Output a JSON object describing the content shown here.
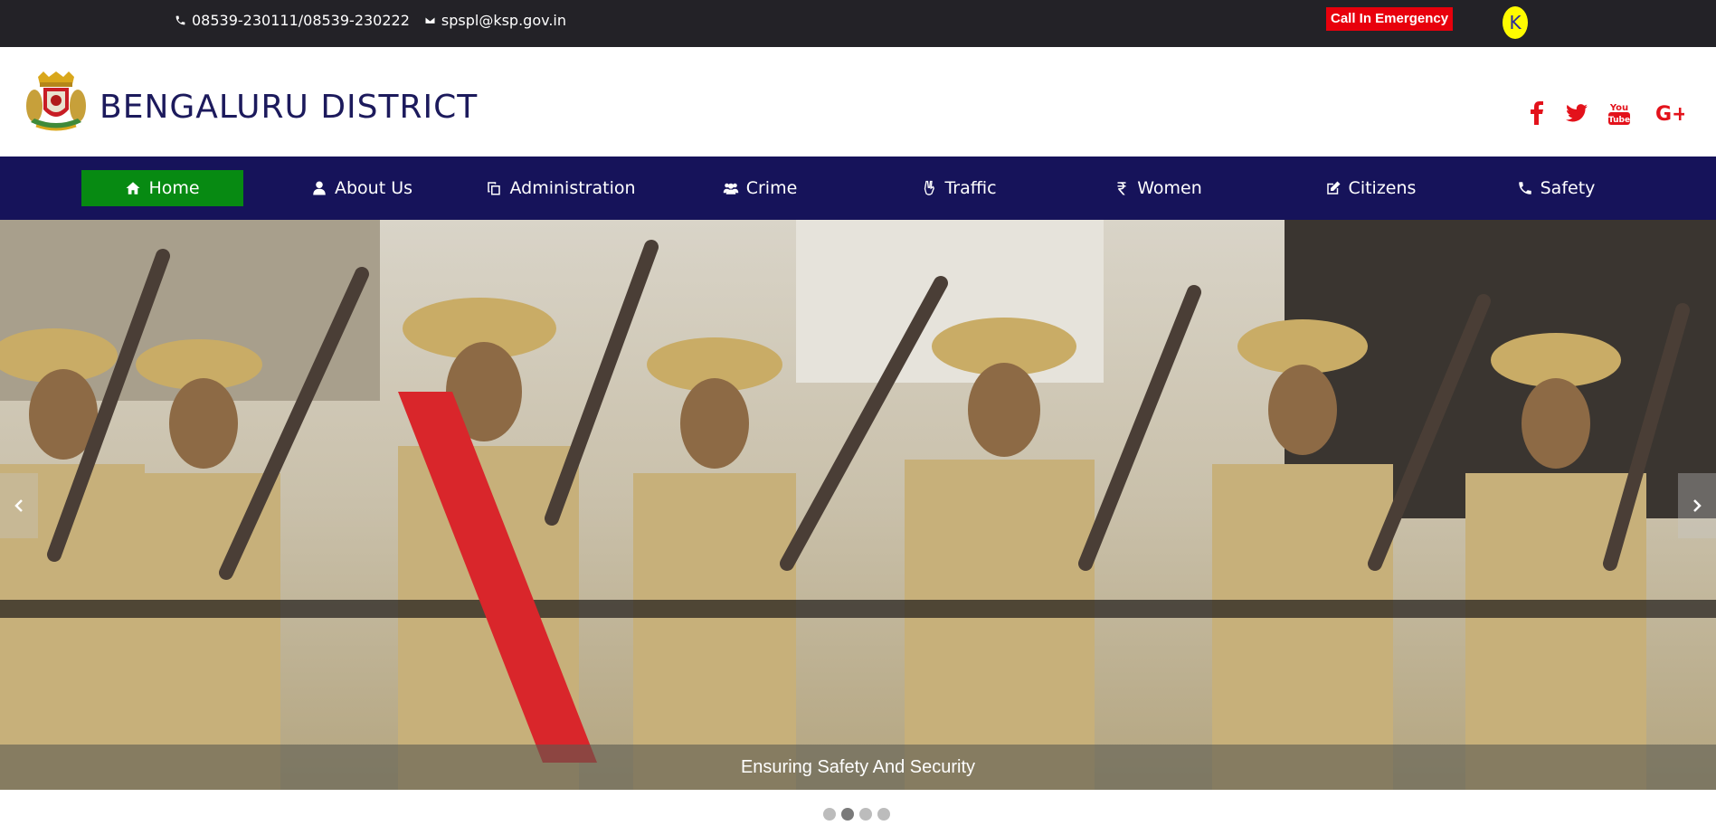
{
  "topbar": {
    "phone": "08539-230111/08539-230222",
    "email": "spspl@ksp.gov.in",
    "emergency_label": "Call In Emergency",
    "user_initial": "K"
  },
  "header": {
    "title": "BENGALURU DISTRICT",
    "social": [
      "facebook-icon",
      "twitter-icon",
      "youtube-icon",
      "google-plus-icon"
    ],
    "social_youtube_text": "You Tube",
    "social_gplus_text": "G+"
  },
  "nav": {
    "items": [
      {
        "label": "Home",
        "icon": "home-icon",
        "active": true
      },
      {
        "label": "About Us",
        "icon": "user-icon"
      },
      {
        "label": "Administration",
        "icon": "copy-icon"
      },
      {
        "label": "Crime",
        "icon": "users-icon"
      },
      {
        "label": "Traffic",
        "icon": "hand-icon"
      },
      {
        "label": "Women",
        "icon": "rupee-icon"
      },
      {
        "label": "Citizens",
        "icon": "edit-icon"
      },
      {
        "label": "Safety",
        "icon": "phone-icon"
      }
    ]
  },
  "slider": {
    "caption": "Ensuring Safety And Security",
    "slide_count": 4,
    "active_index": 1
  },
  "colors": {
    "topbar": "#232227",
    "nav": "#16135a",
    "active_nav": "#078a12",
    "emergency": "#e8000c",
    "title": "#1c1a5c",
    "social": "#e3121b"
  }
}
